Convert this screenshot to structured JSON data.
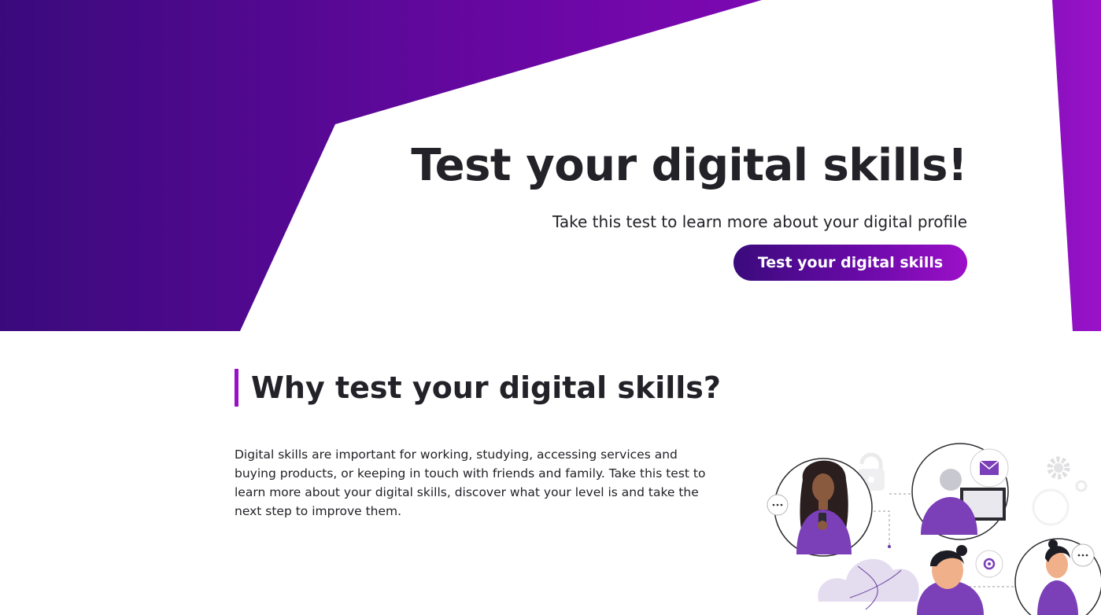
{
  "hero": {
    "title": "Test your digital skills!",
    "subtitle": "Take this test to learn more about your digital profile",
    "cta_label": "Test your digital skills"
  },
  "why_section": {
    "heading": "Why test your digital skills?",
    "body": "Digital skills are important for working, studying, accessing services and buying products, or keeping in touch with friends and family. Take this test to learn more about your digital skills, discover what your level is and take the next step to improve them."
  },
  "colors": {
    "hero_dark": "#3a0a7c",
    "hero_light": "#8c10c0",
    "accent": "#9b10c6",
    "text": "#222228",
    "illustration_purple": "#7b3fb8"
  },
  "illustration": {
    "icons": [
      "chat-bubble-icon",
      "envelope-icon",
      "padlock-icon",
      "gear-icon",
      "at-sign-icon",
      "cloud-icon"
    ]
  }
}
